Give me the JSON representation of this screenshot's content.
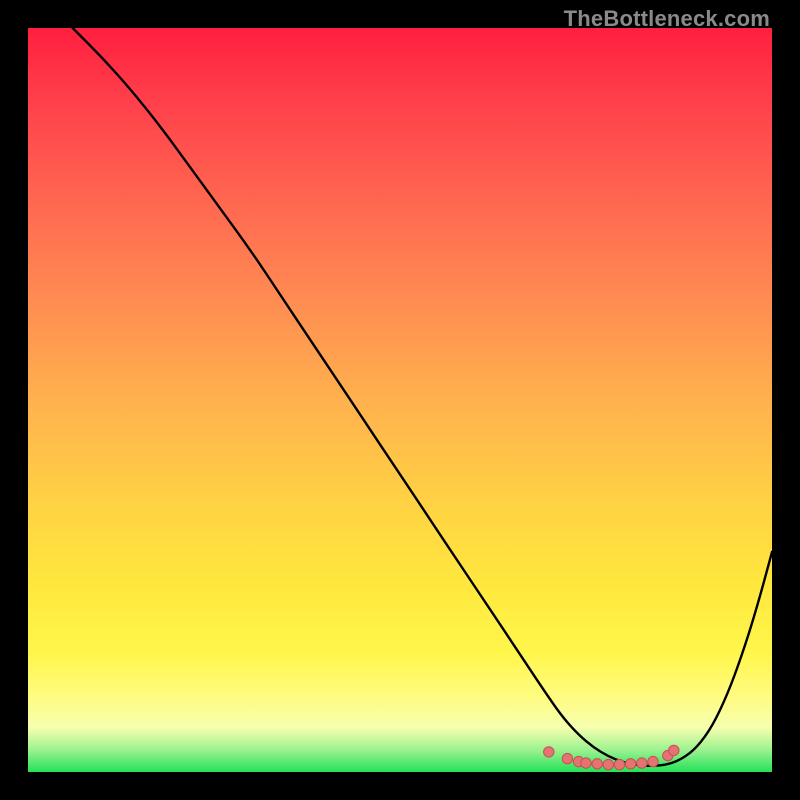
{
  "watermark": "TheBottleneck.com",
  "colors": {
    "frame": "#000000",
    "curve_stroke": "#000000",
    "marker_fill": "#e57373",
    "marker_stroke": "#c94f4f",
    "gradient_stops": [
      "#ff1f3e",
      "#ff3d4a",
      "#ff6350",
      "#ff8a52",
      "#ffb14e",
      "#ffd243",
      "#ffe83e",
      "#fff64b",
      "#fffc82",
      "#f6ffae",
      "#9df290",
      "#24e159"
    ]
  },
  "chart_data": {
    "type": "line",
    "title": "",
    "xlabel": "",
    "ylabel": "",
    "xlim": [
      0,
      100
    ],
    "ylim": [
      0,
      100
    ],
    "grid": false,
    "legend": false,
    "series": [
      {
        "name": "curve",
        "x": [
          6,
          10,
          14,
          18,
          22,
          26,
          30,
          34,
          38,
          42,
          46,
          50,
          54,
          58,
          62,
          66,
          70,
          72,
          74,
          76,
          78,
          80,
          82,
          84,
          86,
          88,
          90,
          92,
          94,
          96,
          98,
          100
        ],
        "y": [
          100,
          96,
          91.5,
          86.5,
          81,
          75.5,
          70,
          64,
          58,
          52,
          46,
          40,
          34,
          28,
          22,
          16,
          10,
          7.2,
          5,
          3.3,
          2.1,
          1.3,
          0.9,
          0.8,
          1.0,
          1.8,
          3.4,
          6.2,
          10.4,
          15.8,
          22.2,
          29.6
        ]
      }
    ],
    "markers": [
      {
        "x": 70.0,
        "y": 2.7
      },
      {
        "x": 72.5,
        "y": 1.8
      },
      {
        "x": 74.0,
        "y": 1.4
      },
      {
        "x": 75.0,
        "y": 1.2
      },
      {
        "x": 76.5,
        "y": 1.1
      },
      {
        "x": 78.0,
        "y": 1.0
      },
      {
        "x": 79.5,
        "y": 1.0
      },
      {
        "x": 81.0,
        "y": 1.1
      },
      {
        "x": 82.5,
        "y": 1.2
      },
      {
        "x": 84.0,
        "y": 1.4
      },
      {
        "x": 86.0,
        "y": 2.2
      },
      {
        "x": 86.8,
        "y": 2.9
      }
    ]
  }
}
